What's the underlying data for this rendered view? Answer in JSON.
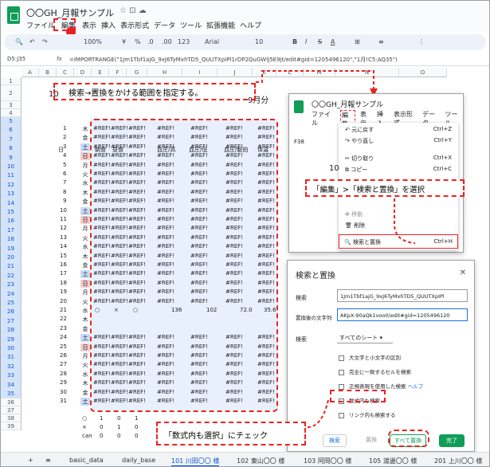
{
  "app": {
    "title": "〇〇GH_月報サンプル",
    "menu": [
      "ファイル",
      "編集",
      "表示",
      "挿入",
      "表示形式",
      "データ",
      "ツール",
      "拡張機能",
      "ヘルプ"
    ]
  },
  "toolbar": {
    "zoom": "100%",
    "font": "Arial",
    "size": "10",
    "items": [
      "¥",
      "%",
      ".0",
      ".00",
      "123"
    ]
  },
  "formula": {
    "ref": "D5:J35",
    "fx": "=IMPORTRANGE(\"1Jm1Tbf1ajG_9xJ6TyMxhTD5_QUUTXpIPl1rDP2QuGWlJ5E9jt/edit#gid=1205496120\",\"1月!C5:AQ35\")"
  },
  "grid": {
    "cols": [
      "A",
      "B",
      "C",
      "D",
      "E",
      "F",
      "G",
      "H",
      "I",
      "J",
      "K",
      "L",
      "M",
      "N",
      "O"
    ],
    "row2_left": "10",
    "row2_right": "9月分",
    "headers": {
      "day": "日",
      "c1": "朝食",
      "c2": "昼食",
      "c3": "血圧/高",
      "c4": "血圧/低",
      "c5": "血圧/脈拍",
      "c6": "体温"
    },
    "days": [
      [
        "1",
        "木"
      ],
      [
        "2",
        "金"
      ],
      [
        "3",
        "土"
      ],
      [
        "4",
        "日"
      ],
      [
        "5",
        "月"
      ],
      [
        "6",
        "火"
      ],
      [
        "7",
        "水"
      ],
      [
        "8",
        "木"
      ],
      [
        "9",
        "金"
      ],
      [
        "10",
        "土"
      ],
      [
        "11",
        "日"
      ],
      [
        "12",
        "月"
      ],
      [
        "13",
        "火"
      ],
      [
        "14",
        "水"
      ],
      [
        "15",
        "木"
      ],
      [
        "16",
        "金"
      ],
      [
        "17",
        "土"
      ],
      [
        "18",
        "日"
      ],
      [
        "19",
        "月"
      ],
      [
        "20",
        "火"
      ],
      [
        "21",
        "水"
      ],
      [
        "22",
        "木"
      ],
      [
        "23",
        "金"
      ],
      [
        "24",
        "土"
      ],
      [
        "25",
        "日"
      ],
      [
        "26",
        "月"
      ],
      [
        "27",
        "火"
      ],
      [
        "28",
        "水"
      ],
      [
        "29",
        "木"
      ],
      [
        "30",
        "金"
      ],
      [
        "31",
        "土"
      ]
    ],
    "row25": {
      "d": "○",
      "e": "×",
      "f": "○",
      "g": "136",
      "h": "102",
      "i": "72.0",
      "j": "35.6"
    },
    "bottom": [
      [
        "37",
        "○",
        "1",
        "0",
        "1"
      ],
      [
        "38",
        "×",
        "0",
        "1",
        "0"
      ],
      [
        "39",
        "can",
        "0",
        "0",
        "0"
      ]
    ],
    "ref_text": "#REF!"
  },
  "callouts": {
    "range": "検索→置換をかける範囲を指定する。",
    "select": "「編集」>「検索と置換」を選択",
    "check": "「数式内も選択」にチェック"
  },
  "edit_menu": {
    "title": "〇〇GH_月報サンプル",
    "menu": [
      "ファイル",
      "編集",
      "表示",
      "挿入",
      "表示形式",
      "データ",
      "ツール"
    ],
    "items": [
      {
        "label": "元に戻す",
        "key": "Ctrl+Z"
      },
      {
        "label": "やり直し",
        "key": "Ctrl+Y"
      },
      {
        "label": "切り取り",
        "key": "Ctrl+X"
      },
      {
        "label": "コピー",
        "key": "Ctrl+C"
      },
      {
        "label": "移動",
        "key": ""
      },
      {
        "label": "削除",
        "key": ""
      },
      {
        "label": "検索と置換",
        "key": "Ctrl+H"
      }
    ],
    "ref": "F38",
    "row10": "10"
  },
  "dialog": {
    "title": "検索と置換",
    "search_label": "検索",
    "search_value": "1Jm1Tbf1ajG_9xJ6TyMxhTD5_QUUTXpIPl",
    "replace_label": "置換後の文字列",
    "replace_value": "AKpX-90aQk1voo0/edit#gid=1205496120",
    "scope_label": "検索",
    "scope_value": "すべてのシート",
    "options": [
      "大文字と小文字の区別",
      "完全に一致するセルを検索",
      "正規表現を使用した検索",
      "数式内も検索",
      "リンク内も検索する"
    ],
    "help": "ヘルプ",
    "btn_search": "検索",
    "btn_replace": "置換",
    "btn_replace_all": "すべて置換",
    "btn_done": "完了"
  },
  "tabs": [
    "basic_data",
    "daily_base",
    "101 川田〇〇 様",
    "102 東山〇〇 様",
    "103 阿岡〇〇 様",
    "105 渡邊〇〇 様",
    "201 上川〇〇 様"
  ]
}
